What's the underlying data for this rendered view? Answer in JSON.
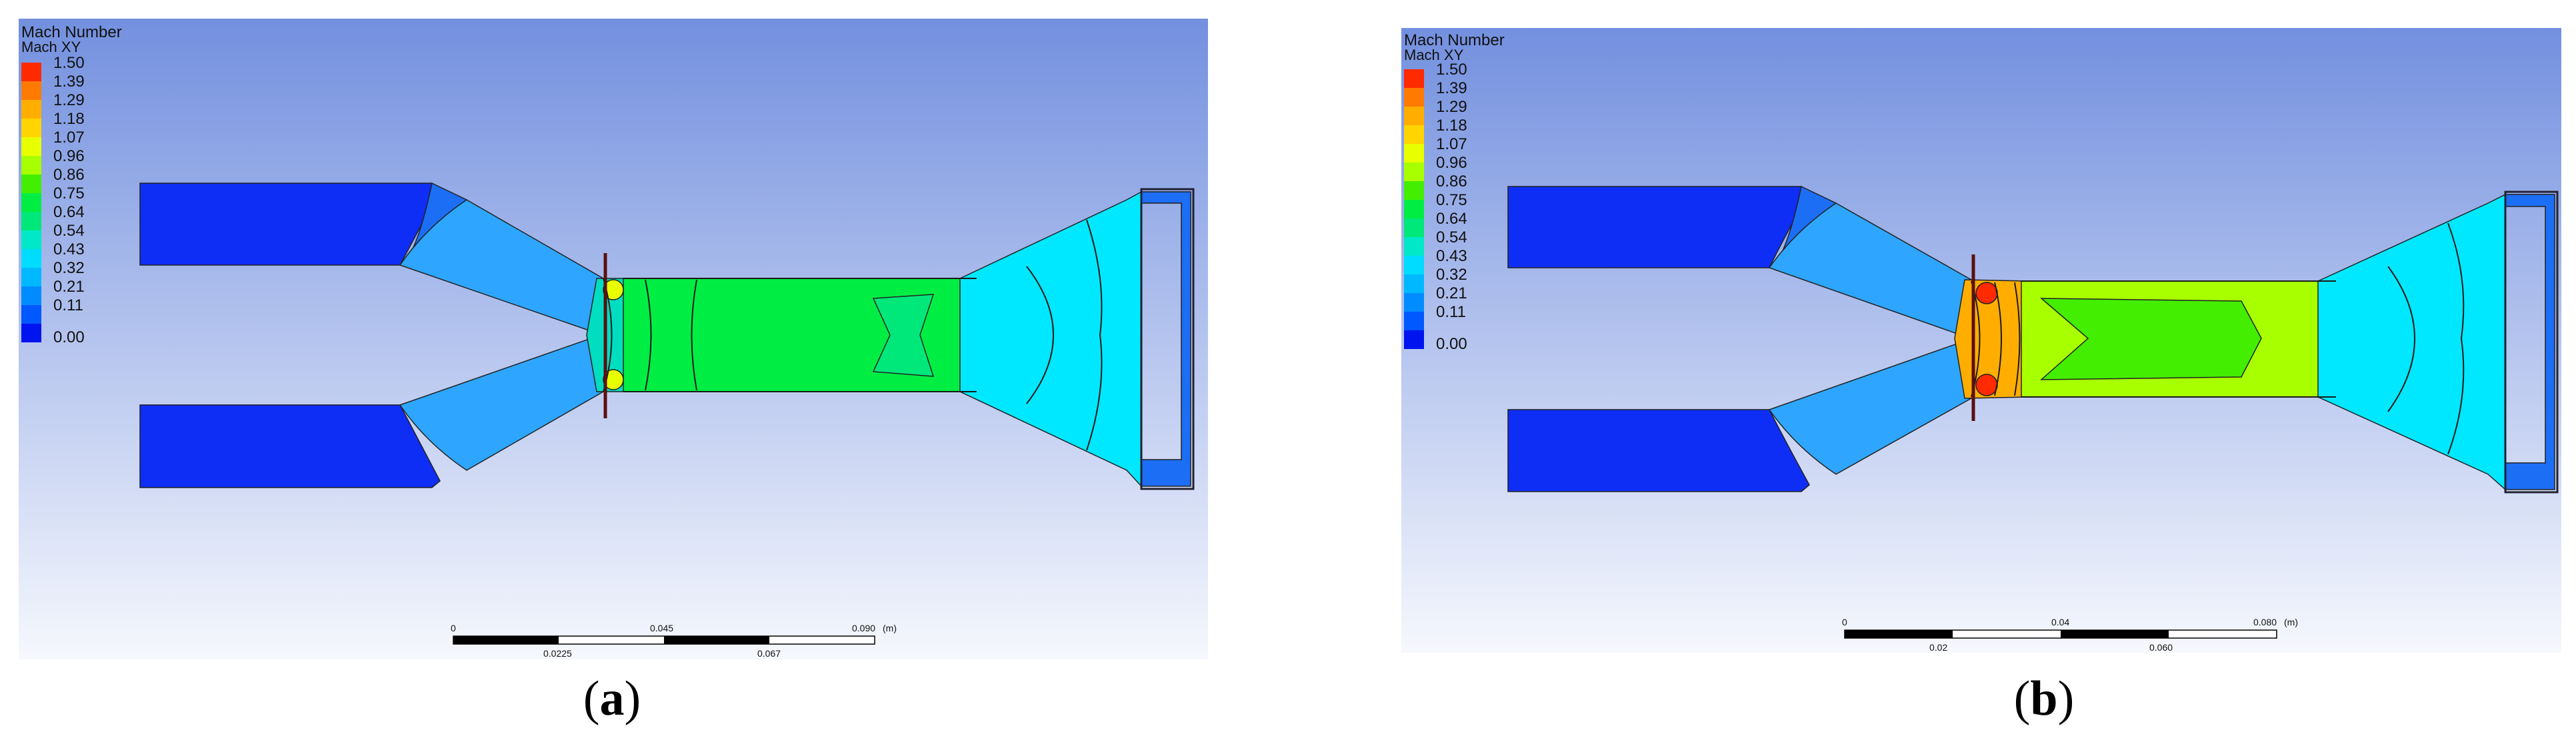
{
  "legend": {
    "title": "Mach Number",
    "subtitle": "Mach XY",
    "values": [
      "1.50",
      "1.39",
      "1.29",
      "1.18",
      "1.07",
      "0.96",
      "0.86",
      "0.75",
      "0.64",
      "0.54",
      "0.43",
      "0.32",
      "0.21",
      "0.11",
      "0.00"
    ],
    "colors": [
      "#ff2a00",
      "#ff7a00",
      "#ffae00",
      "#ffd400",
      "#e8ff00",
      "#a8ff00",
      "#44ee00",
      "#00ee44",
      "#00e87a",
      "#00e8c8",
      "#00dcff",
      "#00b8ff",
      "#008cff",
      "#0058ff",
      "#0014f0"
    ]
  },
  "panels": [
    {
      "caption_letter": "a",
      "scale_bar": {
        "top_labels": [
          "0",
          "0.045",
          "0.090"
        ],
        "unit": "(m)",
        "bottom_labels": [
          "0.0225",
          "0.067"
        ]
      },
      "colors": {
        "inlet": "#0e2ef5",
        "diffuser_a": "#1c6ef5",
        "diffuser_b": "#2ea6ff",
        "throat": "#00ddc0",
        "mixer": "#00ee44",
        "mixer_core": "#00e87a",
        "outlet": "#00e8ff",
        "outlet_edge": "#1c6ef5",
        "hotspot": "#e8ff00"
      }
    },
    {
      "caption_letter": "b",
      "scale_bar": {
        "top_labels": [
          "0",
          "0.04",
          "0.080"
        ],
        "unit": "(m)",
        "bottom_labels": [
          "0.02",
          "0.060"
        ]
      },
      "colors": {
        "inlet": "#0e2ef5",
        "diffuser_a": "#1c6ef5",
        "diffuser_b": "#2ea6ff",
        "throat": "#ffae00",
        "mixer": "#a8ff00",
        "mixer_core": "#44ee00",
        "outlet": "#00e8ff",
        "outlet_edge": "#1c6ef5",
        "hotspot": "#ff2a00"
      }
    }
  ]
}
